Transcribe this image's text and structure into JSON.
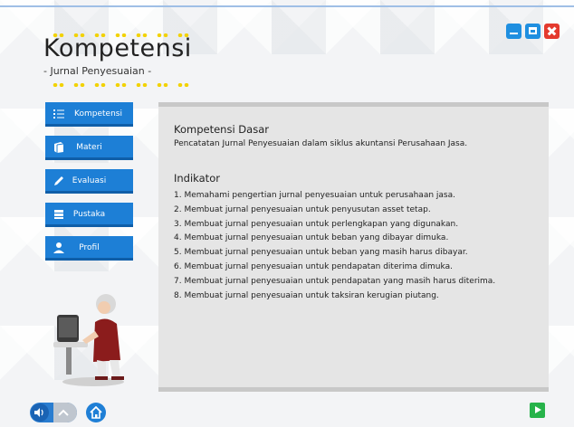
{
  "header": {
    "title": "Kompetensi",
    "subtitle": "- Jurnal Penyesuaian -"
  },
  "menu": {
    "items": [
      {
        "label": "Kompetensi",
        "icon": "list-icon"
      },
      {
        "label": "Materi",
        "icon": "book-icon"
      },
      {
        "label": "Evaluasi",
        "icon": "pencil-icon"
      },
      {
        "label": "Pustaka",
        "icon": "library-icon"
      },
      {
        "label": "Profil",
        "icon": "user-icon"
      }
    ]
  },
  "content": {
    "kompetensi_dasar_heading": "Kompetensi Dasar",
    "kompetensi_dasar_text": "Pencatatan Jurnal Penyesuaian dalam siklus akuntansi Perusahaan Jasa.",
    "indikator_heading": "Indikator",
    "indikator": [
      "1. Memahami pengertian jurnal penyesuaian untuk perusahaan jasa.",
      "2. Membuat jurnal penyesuaian untuk penyusutan asset tetap.",
      "3. Membuat jurnal penyesuaian untuk perlengkapan yang digunakan.",
      "4. Membuat jurnal penyesuaian untuk beban yang dibayar dimuka.",
      "5. Membuat jurnal penyesuaian untuk beban yang masih harus dibayar.",
      "6. Membuat jurnal penyesuaian untuk pendapatan diterima dimuka.",
      "7. Membuat jurnal penyesuaian untuk pendapatan yang masih harus diterima.",
      "8. Membuat jurnal penyesuaian untuk taksiran kerugian piutang."
    ]
  },
  "colors": {
    "accent": "#1d7fd6",
    "close": "#e43a2e",
    "next": "#27b34a",
    "dots": "#f2d200"
  }
}
